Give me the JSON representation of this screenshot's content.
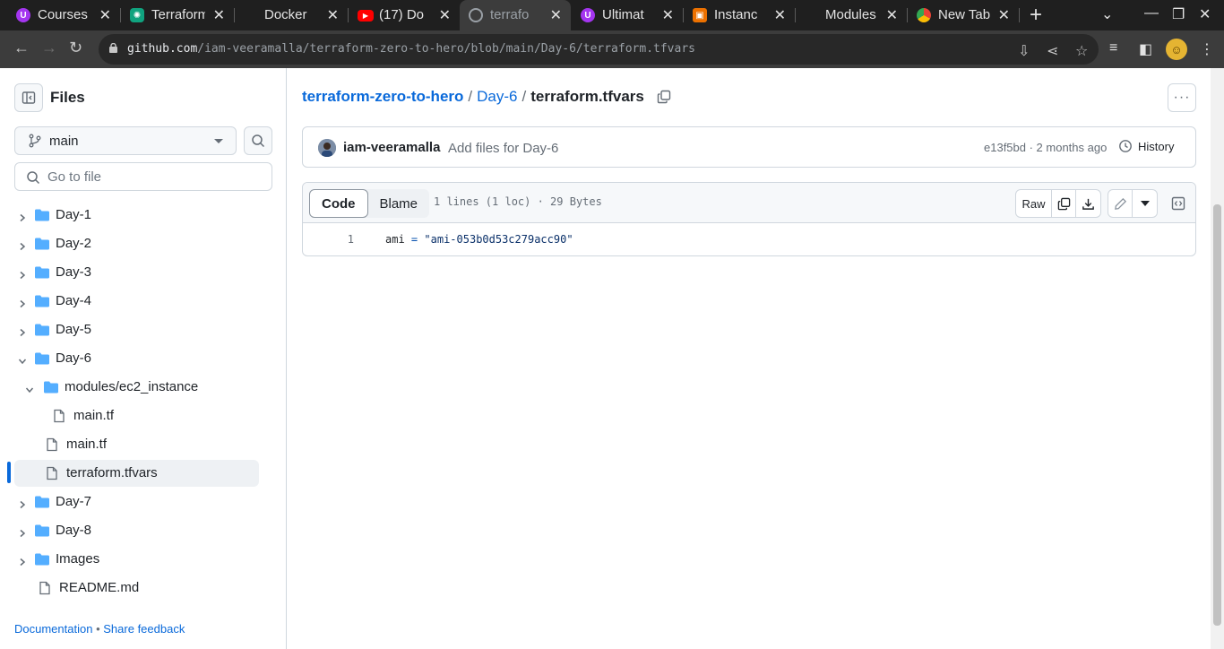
{
  "browser": {
    "tabs": [
      {
        "title": "Courses",
        "icon": "udemy-icon",
        "color": "#a435f0"
      },
      {
        "title": "Terraform",
        "icon": "chatgpt-icon",
        "color": "#10a37f"
      },
      {
        "title": "Docker",
        "icon": "blank-icon",
        "color": "#1f1f1f"
      },
      {
        "title": "(17) Do",
        "icon": "youtube-icon",
        "color": "#ff0000"
      },
      {
        "title": "terrafo",
        "icon": "github-icon",
        "color": "#3c3c3c"
      },
      {
        "title": "Ultimat",
        "icon": "udemy-icon",
        "color": "#a435f0"
      },
      {
        "title": "Instanc",
        "icon": "aws-icon",
        "color": "#ed7100"
      },
      {
        "title": "Modules",
        "icon": "blank-icon",
        "color": "#1f1f1f"
      },
      {
        "title": "New Tab",
        "icon": "chrome-icon",
        "color": "#4285f4"
      }
    ],
    "url_host": "github.com",
    "url_path": "/iam-veeramalla/terraform-zero-to-hero/blob/main/Day-6/terraform.tfvars"
  },
  "sidebar": {
    "title": "Files",
    "branch": "main",
    "goto_placeholder": "Go to file",
    "tree": [
      {
        "label": "Day-1",
        "type": "folder"
      },
      {
        "label": "Day-2",
        "type": "folder"
      },
      {
        "label": "Day-3",
        "type": "folder"
      },
      {
        "label": "Day-4",
        "type": "folder"
      },
      {
        "label": "Day-5",
        "type": "folder"
      },
      {
        "label": "Day-6",
        "type": "folder-open"
      },
      {
        "label": "modules/ec2_instance",
        "type": "folder-open"
      },
      {
        "label": "main.tf",
        "type": "file"
      },
      {
        "label": "main.tf",
        "type": "file"
      },
      {
        "label": "terraform.tfvars",
        "type": "file"
      },
      {
        "label": "Day-7",
        "type": "folder"
      },
      {
        "label": "Day-8",
        "type": "folder"
      },
      {
        "label": "Images",
        "type": "folder"
      },
      {
        "label": "README.md",
        "type": "file"
      }
    ],
    "footer_docs": "Documentation",
    "footer_sep": "•",
    "footer_feedback": "Share feedback"
  },
  "breadcrumb": {
    "repo": "terraform-zero-to-hero",
    "sep": "/",
    "folder": "Day-6",
    "file": "terraform.tfvars"
  },
  "commit": {
    "author": "iam-veeramalla",
    "message": "Add files for Day-6",
    "meta": "e13f5bd · 2 months ago",
    "history_label": "History"
  },
  "file": {
    "tab_code": "Code",
    "tab_blame": "Blame",
    "info": "1 lines (1 loc) · 29 Bytes",
    "raw_label": "Raw",
    "line_number": "1",
    "code_key": "ami",
    "code_op": "=",
    "code_value": "\"ami-053b0d53c279acc90\""
  },
  "colors": {
    "link": "#0969da",
    "border": "#d0d7de",
    "selected_bar": "#0969da",
    "folder": "#54aeff"
  }
}
